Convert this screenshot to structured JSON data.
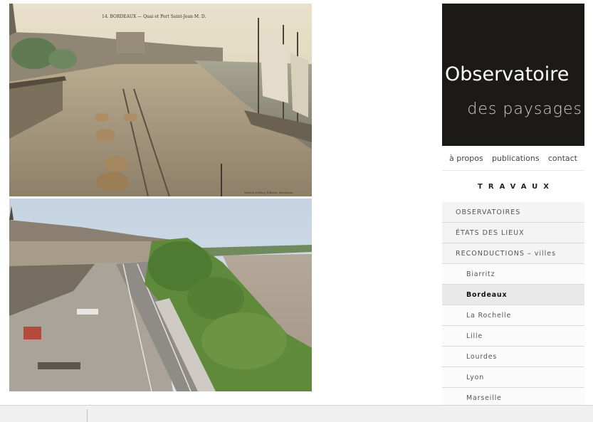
{
  "images": {
    "old_postcard": {
      "caption": "14. BORDEAUX — Quai et Port Saint-Jean   M. D.",
      "footer": "Marcel Delboy, Éditeur, Bordeaux"
    },
    "new_photo": {}
  },
  "logo": {
    "title": "Observatoire",
    "subtitle": "des paysages"
  },
  "topnav": {
    "items": [
      "à propos",
      "publications",
      "contact"
    ]
  },
  "section_title": "TRAVAUX",
  "menu": {
    "items": [
      {
        "label": "OBSERVATOIRES"
      },
      {
        "label": "ÉTATS DES LIEUX"
      },
      {
        "label": "RECONDUCTIONS – villes"
      }
    ],
    "subitems": [
      {
        "label": "Biarritz"
      },
      {
        "label": "Bordeaux",
        "active": true
      },
      {
        "label": "La Rochelle"
      },
      {
        "label": "Lille"
      },
      {
        "label": "Lourdes"
      },
      {
        "label": "Lyon"
      },
      {
        "label": "Marseille"
      }
    ]
  },
  "colors": {
    "logo_bg": "#1c1a16",
    "menu_bg": "#f4f4f4",
    "active_bg": "#e9e9e9"
  }
}
